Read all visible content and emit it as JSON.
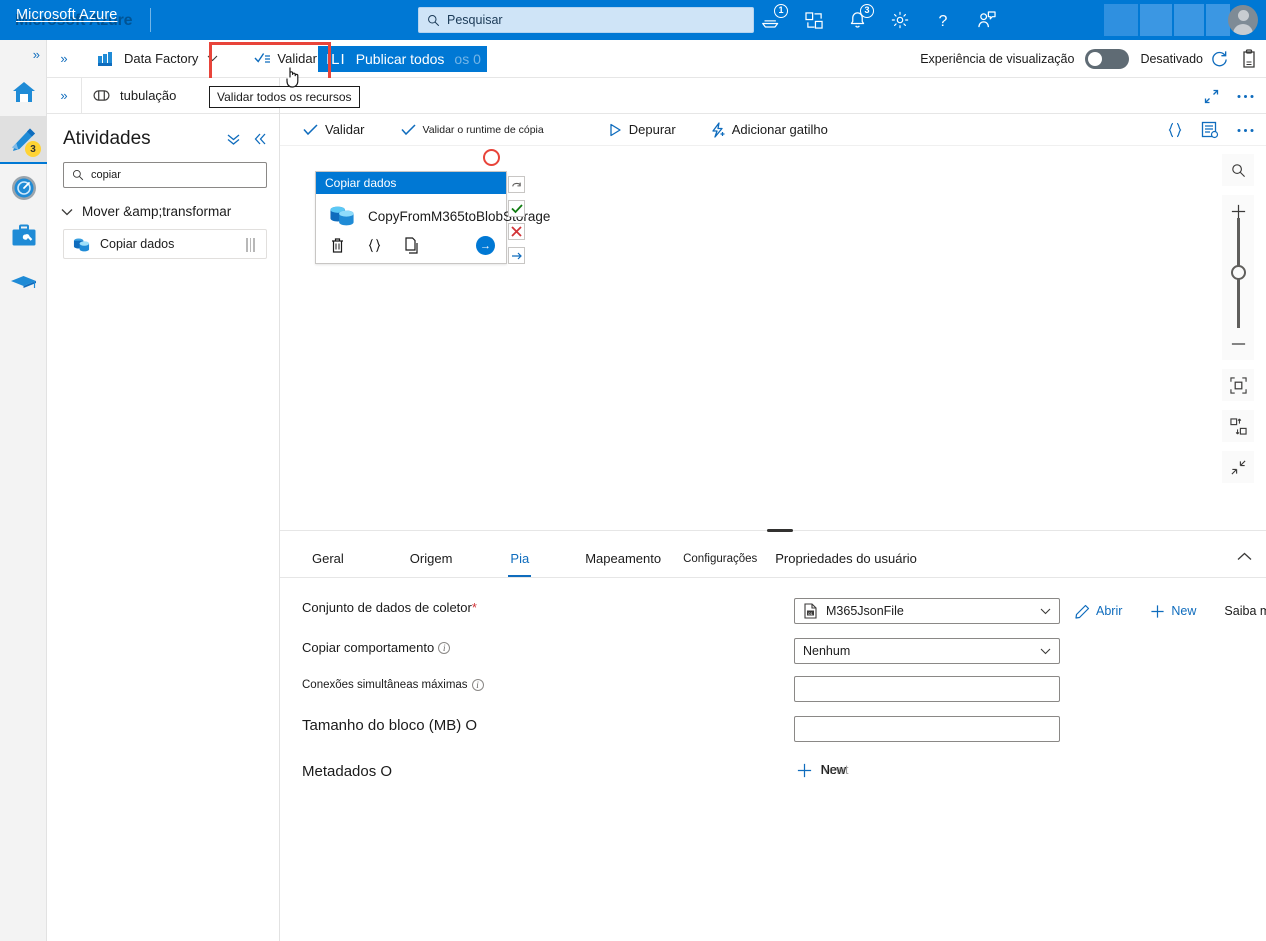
{
  "topbar": {
    "brand": "Microsoft Azure",
    "brand_ghost": "Microsoft Azure",
    "search_placeholder": "Pesquisar",
    "cloud_shell_badge": "1",
    "notifications_badge": "3",
    "icons": [
      "cloud-shell-icon",
      "directory-switch-icon",
      "notifications-bell-icon",
      "settings-gear-icon",
      "help-question-icon",
      "feedback-icon"
    ]
  },
  "rail": {
    "expand": "»",
    "items": [
      {
        "name": "home",
        "icon": "home-icon"
      },
      {
        "name": "author",
        "icon": "pencil-icon",
        "badge": "3",
        "selected": true
      },
      {
        "name": "monitor",
        "icon": "monitor-gauge-icon"
      },
      {
        "name": "manage",
        "icon": "toolbox-icon"
      },
      {
        "name": "learn",
        "icon": "graduation-cap-icon"
      }
    ]
  },
  "cmdbar": {
    "expand": "»",
    "factory_label": "Data Factory",
    "validate_all_label": "Validar tudo",
    "tooltip": "Validar todos os recursos",
    "publish_prefix": "ILI",
    "publish_label": "Publicar todos",
    "publish_suffix": " os 0",
    "preview_label": "Experiência de visualização",
    "preview_state": "Desativado",
    "refresh_icon": "refresh-icon",
    "feedback_icon": "feedback-clipboard-icon"
  },
  "leftpanel": {
    "expand": "»",
    "pipeline_tab": "tubulação",
    "activities_title": "Atividades",
    "search_value": "copiar",
    "group_label": "Mover &amp;transformar",
    "items": [
      {
        "label": "Copiar dados",
        "icon": "copy-data-icon"
      }
    ]
  },
  "canvasbar": {
    "validate_label": "Validar",
    "validate_copy_runtime_label": "Validar o runtime de cópia",
    "debug_label": "Depurar",
    "add_trigger_label": "Adicionar gatilho",
    "json_icon": "code-braces-icon",
    "properties_icon": "properties-list-icon",
    "more_icon": "ellipsis-icon"
  },
  "canvas": {
    "node": {
      "header": "Copiar dados",
      "name": "CopyFromM365toBlobStorage",
      "icon": "copy-data-icon",
      "actions": [
        "delete-icon",
        "code-braces-icon",
        "duplicate-icon"
      ],
      "go_icon": "→"
    },
    "connectors": [
      {
        "name": "on-completion",
        "glyph": "↷",
        "color": "#5f5e5c"
      },
      {
        "name": "on-success",
        "glyph": "✓",
        "color": "#107c10"
      },
      {
        "name": "on-failure",
        "glyph": "✕",
        "color": "#d13438"
      },
      {
        "name": "on-skip",
        "glyph": "→",
        "color": "#0f6cbd"
      }
    ],
    "zoom_controls": [
      {
        "name": "zoom-search",
        "glyph": "search-icon"
      },
      {
        "name": "zoom-in",
        "glyph": "+"
      },
      {
        "name": "zoom-out",
        "glyph": "–"
      },
      {
        "name": "fit-to-screen",
        "glyph": "fit-icon"
      },
      {
        "name": "auto-align",
        "glyph": "align-icon"
      },
      {
        "name": "collapse-all",
        "glyph": "collapse-icon"
      }
    ]
  },
  "props": {
    "tabs": [
      {
        "label": "Geral",
        "active": false
      },
      {
        "label": "Origem",
        "active": false
      },
      {
        "label": "Pia",
        "active": true
      },
      {
        "label": "Mapeamento",
        "active": false
      },
      {
        "label": "Configurações",
        "active": false,
        "small": true
      },
      {
        "label": "Propriedades do usuário",
        "active": false
      }
    ],
    "fields": [
      {
        "label": "Conjunto de dados de coletor",
        "required": true,
        "value": "M365JsonFile",
        "control": "dropdown",
        "icon": "dataset-file-icon"
      },
      {
        "label": "Copiar comportamento",
        "info": true,
        "value": "Nenhum",
        "control": "dropdown"
      },
      {
        "label": "Conexões simultâneas máximas",
        "info": true,
        "value": "",
        "control": "text"
      },
      {
        "label": "Tamanho do bloco (MB) O",
        "value": "",
        "control": "text"
      },
      {
        "label": "Metadados O",
        "control": "newbutton"
      }
    ],
    "dataset_actions": [
      {
        "label": "Abrir",
        "icon": "pencil-icon"
      },
      {
        "label": "New",
        "icon": "plus-icon"
      },
      {
        "label": "Saiba mais",
        "icon": "external-link-icon"
      }
    ],
    "new_metadata_label": "New",
    "new_metadata_ghost": "Newt",
    "collapse_icon": "chevron-up-icon"
  },
  "colors": {
    "azure_blue": "#0078d4",
    "link_blue": "#0f6cbd",
    "annotation_red": "#e8443a",
    "success_green": "#107c10",
    "error_red": "#d13438",
    "badge_yellow": "#ffd335"
  }
}
